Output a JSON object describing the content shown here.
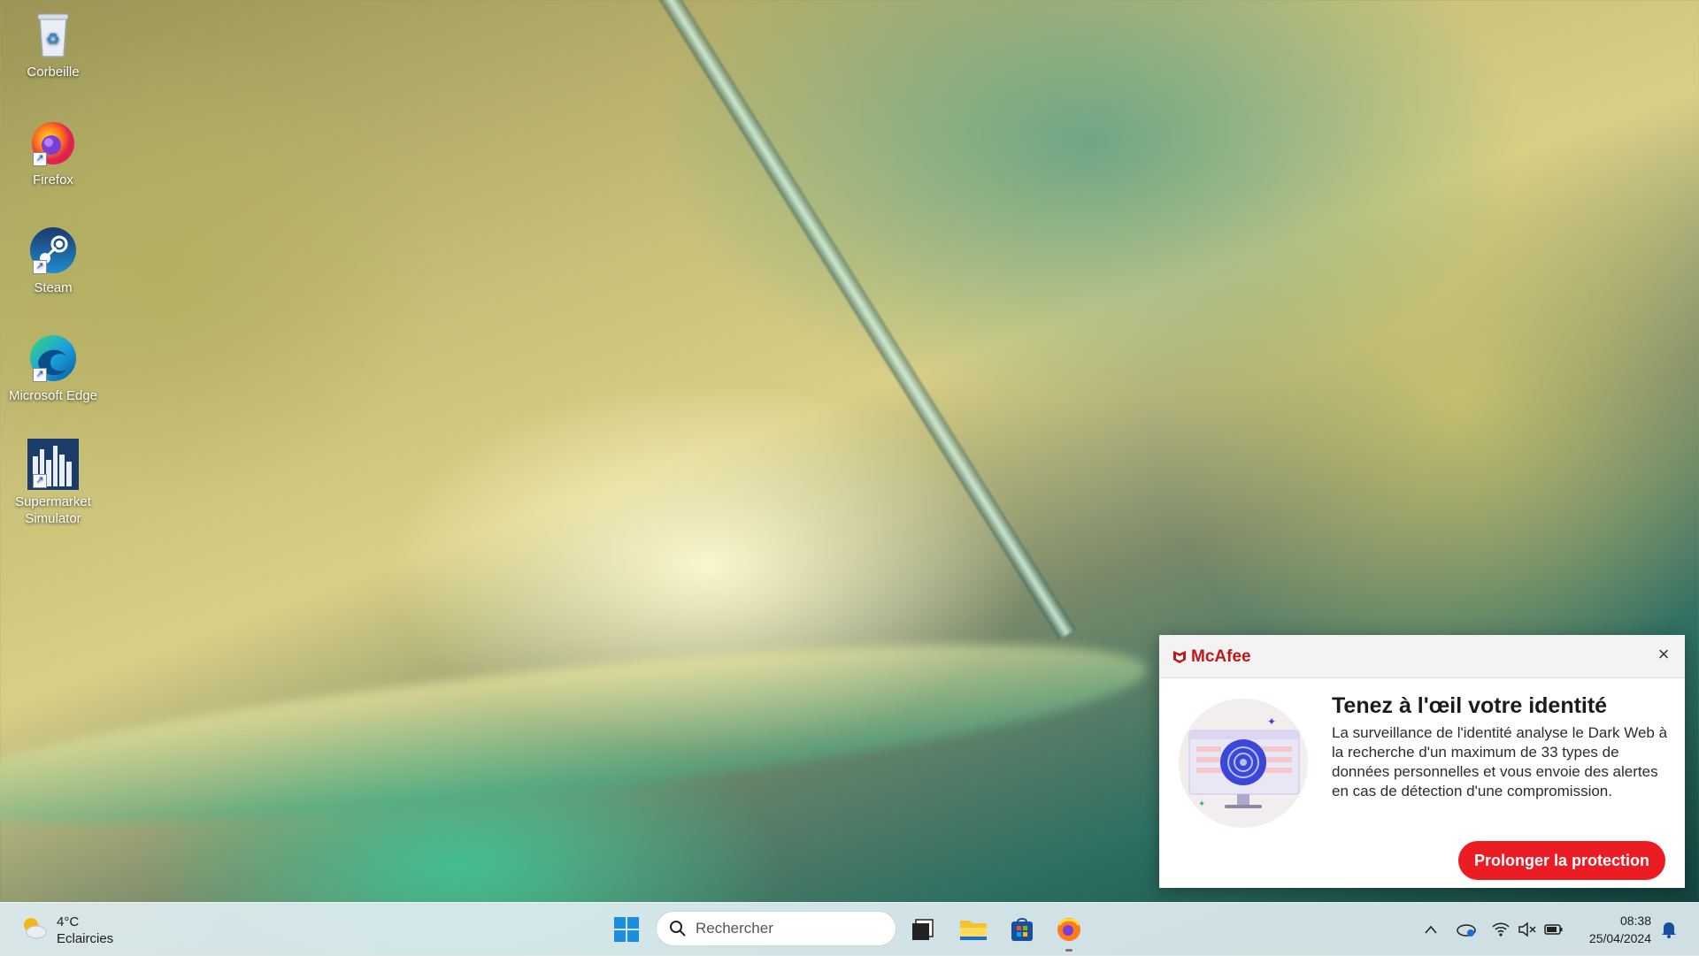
{
  "desktop": {
    "icons": [
      {
        "label": "Corbeille",
        "icon": "recycle-bin-icon"
      },
      {
        "label": "Firefox",
        "icon": "firefox-icon"
      },
      {
        "label": "Steam",
        "icon": "steam-icon"
      },
      {
        "label": "Microsoft Edge",
        "icon": "edge-icon"
      },
      {
        "label": "Supermarket Simulator",
        "icon": "supermarket-simulator-icon"
      }
    ]
  },
  "mcafee": {
    "brand": "McAfee",
    "title": "Tenez à l'œil votre identité",
    "body": "La surveillance de l'identité analyse le Dark Web à la recherche d'un maximum de 33 types de données personnelles et vous envoie des alertes en cas de détection d'une compromission.",
    "cta": "Prolonger la protection",
    "close": "×",
    "accent": "#ec1c24"
  },
  "taskbar": {
    "weather": {
      "temp": "4°C",
      "desc": "Eclaircies"
    },
    "search_placeholder": "Rechercher",
    "clock": {
      "time": "08:38",
      "date": "25/04/2024"
    }
  }
}
